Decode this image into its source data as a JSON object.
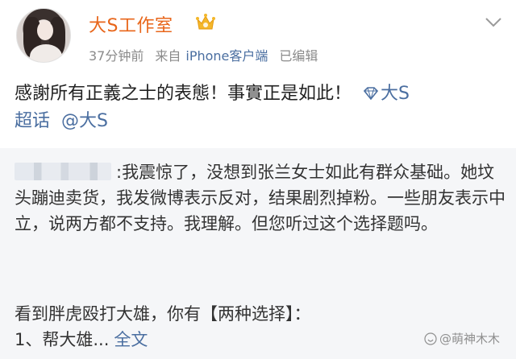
{
  "post": {
    "author": "大S工作室",
    "time": "37分钟前",
    "source_prefix": "来自",
    "source": "iPhone客户端",
    "edited": "已编辑",
    "text": "感謝所有正義之士的表態！事實正是如此！",
    "topic_super": "大S",
    "topic_suffix": "超话",
    "mention": "@大S"
  },
  "repost": {
    "text_line": ":我震惊了，没想到张兰女士如此有群众基础。她坟头蹦迪卖货，我发微博表示反对，结果剧烈掉粉。一些朋友表示中立，说两方都不支持。我理解。但您听过这个选择题吗。",
    "para2_line1": "看到胖虎殴打大雄，你有【两种选择】：",
    "para2_line2": "1、帮大雄...",
    "read_more": "全文"
  },
  "watermark": {
    "text": "@萌神木木"
  },
  "icons": {
    "crown": "crown-icon",
    "chevron": "chevron-down-icon",
    "diamond": "diamond-icon"
  },
  "colors": {
    "author": "#e8661b",
    "link": "#4a6ea0",
    "meta": "#8a8a8a",
    "repost_bg": "#f5f6f8"
  }
}
